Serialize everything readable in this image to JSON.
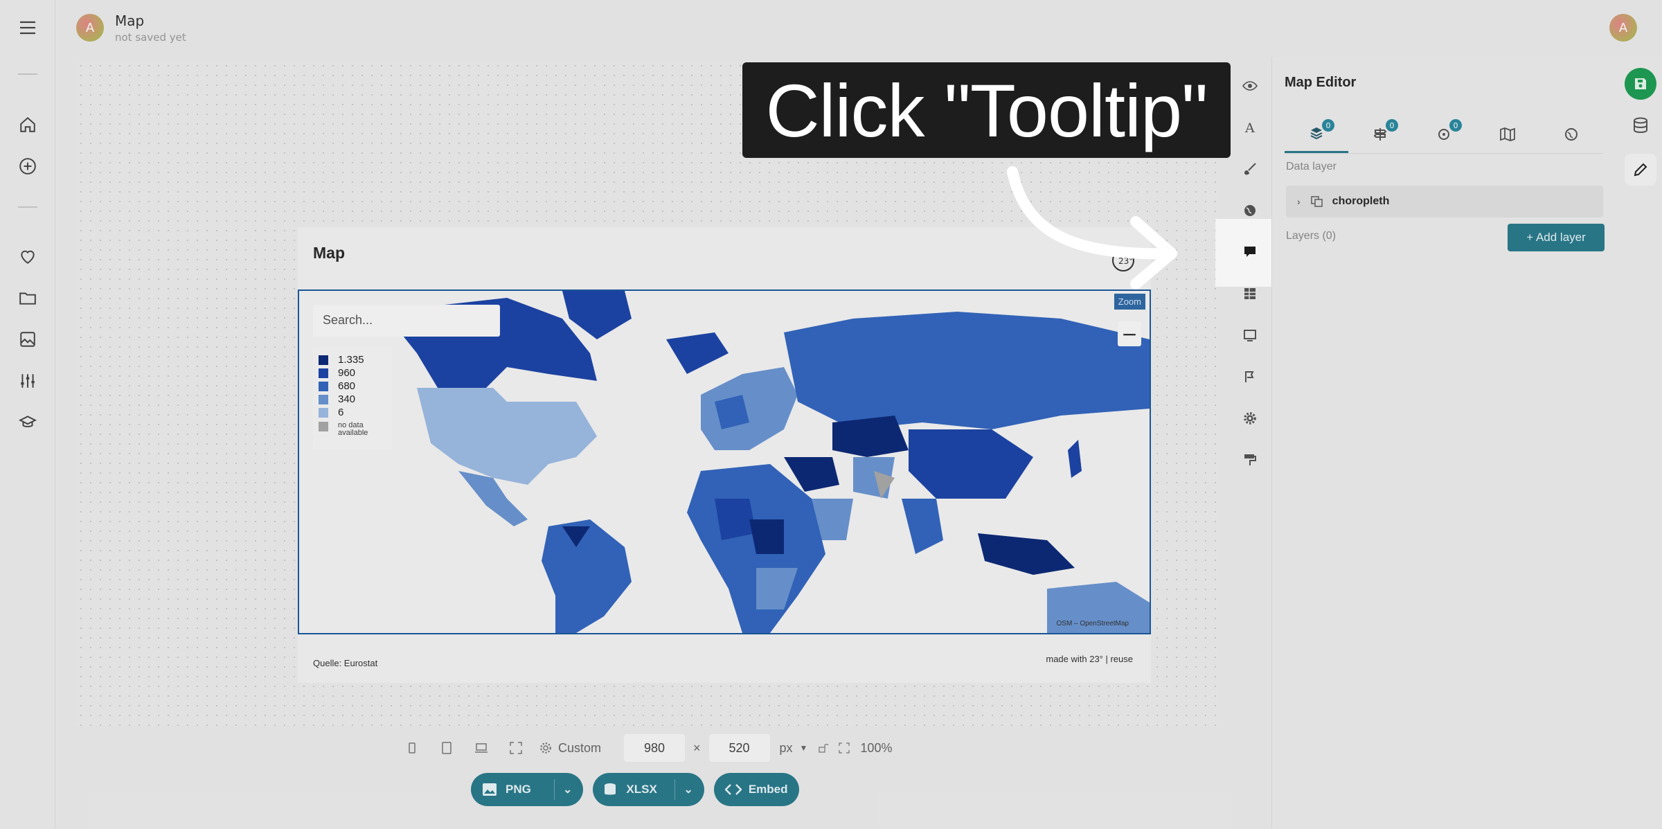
{
  "header": {
    "avatar_letter": "A",
    "doc_title": "Map",
    "doc_subtitle": "not saved yet"
  },
  "left_nav": {
    "icons": [
      "hamburger-icon",
      "home-icon",
      "plus-circle-icon",
      "heart-icon",
      "folder-icon",
      "image-icon",
      "sliders-icon",
      "graduation-cap-icon"
    ]
  },
  "map": {
    "title": "Map",
    "search_placeholder": "Search...",
    "legend": [
      {
        "label": "1.335",
        "color": "#0e2a78"
      },
      {
        "label": "960",
        "color": "#1e45a8"
      },
      {
        "label": "680",
        "color": "#3466bf"
      },
      {
        "label": "340",
        "color": "#6b95d2"
      },
      {
        "label": "6",
        "color": "#9dbbe3"
      }
    ],
    "legend_no_data": "no data available",
    "no_data_color": "#a8a8a8",
    "zoom_label": "Zoom",
    "zoom_minus": "−",
    "attribution": "OSM – OpenStreetMap",
    "source": "Quelle: Eurostat",
    "made_with": "made with 23° | reuse",
    "logo_text": "23°"
  },
  "size_bar": {
    "preset": "Custom",
    "width": "980",
    "height": "520",
    "times": "×",
    "unit": "px",
    "zoom": "100%"
  },
  "export": {
    "png": "PNG",
    "xlsx": "XLSX",
    "embed": "Embed"
  },
  "editor": {
    "title": "Map Editor",
    "tab_badges": [
      "0",
      "0",
      "0"
    ],
    "data_layer_label": "Data layer",
    "layer_name": "choropleth",
    "layers_label": "Layers (0)",
    "add_layer": "+ Add layer"
  },
  "overlay": {
    "instruction": "Click \"Tooltip\""
  },
  "colors": {
    "accent": "#2a7a8c",
    "save_green": "#1f9d55",
    "map_border": "#1c5a9d"
  }
}
